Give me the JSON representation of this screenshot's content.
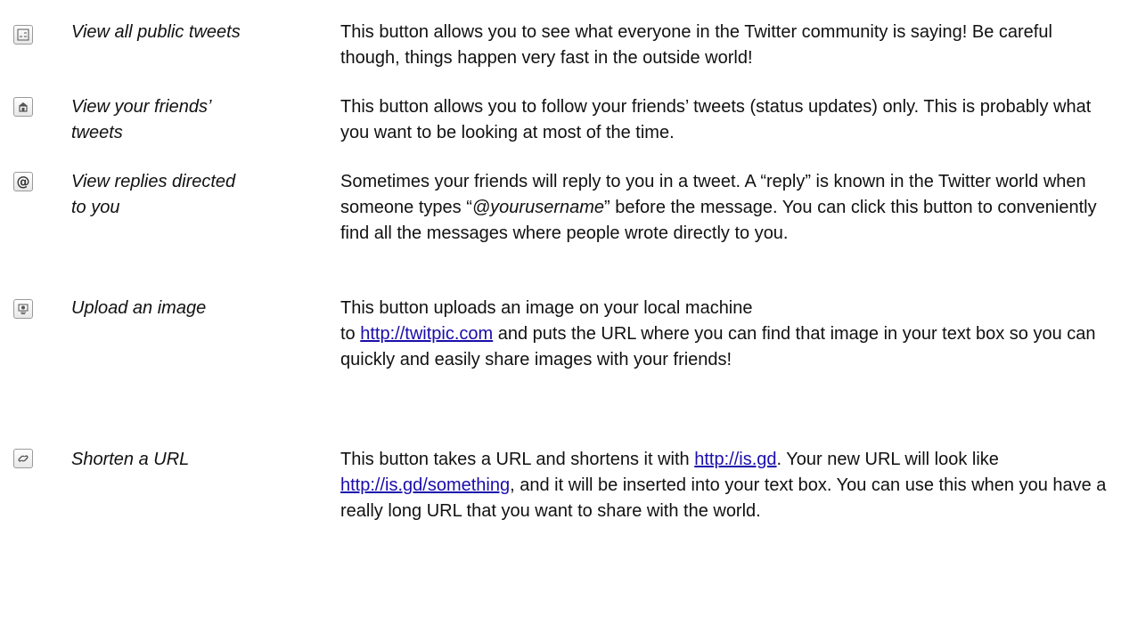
{
  "rows": [
    {
      "icon": "public-timeline-icon",
      "term": "View all public tweets",
      "desc": "This button allows you to see what everyone in the Twitter community is saying! Be careful though, things happen very fast in the outside world!"
    },
    {
      "icon": "home-icon",
      "term_line1": "View your friends’",
      "term_line2": "tweets",
      "desc": "This button allows you to follow your friends’ tweets (status updates) only. This is probably what you want to be looking at most of the time."
    },
    {
      "icon": "at-sign-icon",
      "icon_glyph": "@",
      "term_line1": "View replies directed",
      "term_line2": "to you",
      "desc_a": "Sometimes your friends will reply to you in a tweet. A “reply” is known in the Twitter world when someone types “",
      "desc_em": "@yourusername",
      "desc_b": "” before the message. You can click this button to conveniently find all the messages where people wrote directly to you."
    },
    {
      "icon": "upload-image-icon",
      "term": "Upload an image",
      "desc_a": "This button uploads an image on your local machine",
      "desc_link": "http://twitpic.com",
      "desc_b": " and puts the URL where you can find that image in your text box so you can quickly and easily share images with your friends!"
    },
    {
      "icon": "shorten-url-icon",
      "term": "Shorten a URL",
      "desc_a": "This button takes a URL and shortens it with ",
      "desc_link1": "http://is.gd",
      "desc_b": ". Your new URL will look like ",
      "desc_link2": "http://is.gd/something",
      "desc_c": ", and it will be inserted into your text box. You can use this when you have a really long URL that you want to share with the world."
    }
  ]
}
